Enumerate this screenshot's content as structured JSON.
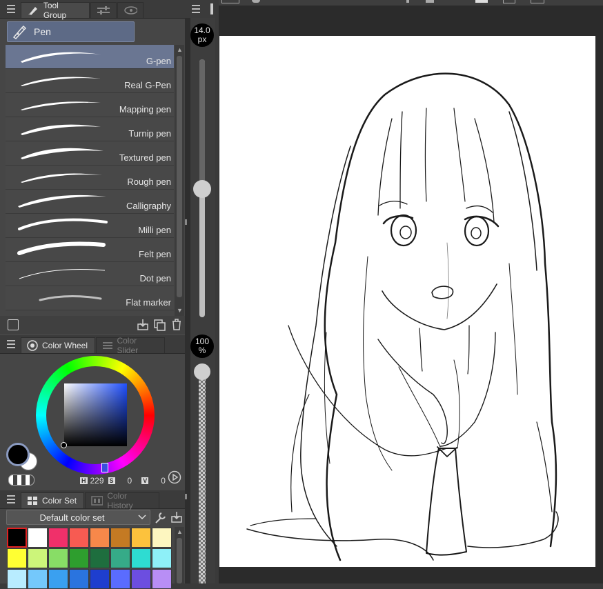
{
  "tool_panel": {
    "tabs": [
      {
        "label": "Tool Group",
        "icon": "brush-tab-icon"
      },
      {
        "label": "",
        "icon": "sliders-tab-icon"
      },
      {
        "label": "",
        "icon": "tool-property-tab-icon"
      }
    ],
    "group_button": {
      "label": "Pen",
      "icon": "pen-icon"
    },
    "brushes": [
      {
        "label": "G-pen",
        "selected": true
      },
      {
        "label": "Real G-Pen",
        "selected": false
      },
      {
        "label": "Mapping pen",
        "selected": false
      },
      {
        "label": "Turnip pen",
        "selected": false
      },
      {
        "label": "Textured pen",
        "selected": false
      },
      {
        "label": "Rough pen",
        "selected": false
      },
      {
        "label": "Calligraphy",
        "selected": false
      },
      {
        "label": "Milli pen",
        "selected": false
      },
      {
        "label": "Felt pen",
        "selected": false
      },
      {
        "label": "Dot pen",
        "selected": false
      },
      {
        "label": "Flat marker",
        "selected": false
      }
    ]
  },
  "color_panel": {
    "tabs": [
      {
        "label": "Color Wheel",
        "icon": "color-wheel-tab-icon"
      },
      {
        "label": "Color Slider",
        "icon": "color-slider-tab-icon"
      }
    ],
    "h_label": "H",
    "h_value": "229",
    "s_label": "S",
    "s_value": "0",
    "v_label": "V",
    "v_value": "0",
    "main_color": "#000000",
    "sub_color": "#ffffff"
  },
  "color_set_panel": {
    "tabs": [
      {
        "label": "Color Set",
        "icon": "palette-tab-icon"
      },
      {
        "label": "Color History",
        "icon": "history-tab-icon"
      }
    ],
    "dropdown_value": "Default color set",
    "swatches_row1": [
      "#000000",
      "#ffffff",
      "#f0306a",
      "#f75b52",
      "#f7884a",
      "#c47a23",
      "#fcc23d",
      "#fdf6c0"
    ],
    "swatches_row2": [
      "#ffff33",
      "#ccf57a",
      "#88dd66",
      "#2e9e2e",
      "#1e6e3e",
      "#36ab88",
      "#2edcd2",
      "#8ef0f8"
    ],
    "swatches_row3": [
      "#b8ecff",
      "#74c8fb",
      "#3aa0f0",
      "#2a74df",
      "#1e3ecf",
      "#5a6cff",
      "#6c4ee0",
      "#b88ef5"
    ]
  },
  "brush_size": {
    "value": "14.0",
    "unit": "px",
    "level": 0.46
  },
  "opacity": {
    "value": "100",
    "unit": "%",
    "level": 1.0
  }
}
